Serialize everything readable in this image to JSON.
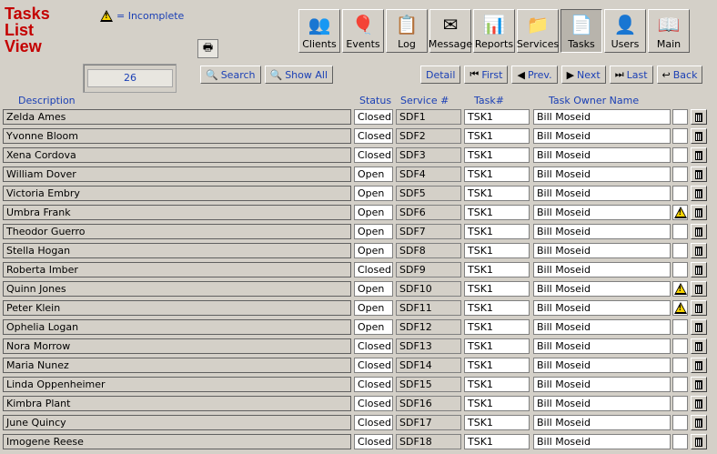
{
  "title": [
    "Tasks",
    "List",
    "View"
  ],
  "legend_text": "= Incomplete",
  "count": "26",
  "nav": [
    {
      "label": "Clients",
      "icon": "clients-icon"
    },
    {
      "label": "Events",
      "icon": "events-icon"
    },
    {
      "label": "Log",
      "icon": "log-icon"
    },
    {
      "label": "Message",
      "icon": "message-icon"
    },
    {
      "label": "Reports",
      "icon": "reports-icon"
    },
    {
      "label": "Services",
      "icon": "services-icon"
    },
    {
      "label": "Tasks",
      "icon": "tasks-icon"
    },
    {
      "label": "Users",
      "icon": "users-icon"
    },
    {
      "label": "Main",
      "icon": "main-icon"
    }
  ],
  "toolbar_left": [
    {
      "label": "Search"
    },
    {
      "label": "Show All"
    }
  ],
  "toolbar_right": [
    {
      "label": "Detail"
    },
    {
      "label": "First"
    },
    {
      "label": "Prev."
    },
    {
      "label": "Next"
    },
    {
      "label": "Last"
    },
    {
      "label": "Back"
    }
  ],
  "columns": {
    "description": "Description",
    "status": "Status",
    "service": "Service #",
    "task": "Task#",
    "owner": "Task Owner Name"
  },
  "rows": [
    {
      "desc": "Zelda Ames",
      "status": "Closed",
      "svc": "SDF1",
      "task": "TSK1",
      "owner": "Bill Moseid",
      "warn": false
    },
    {
      "desc": "Yvonne Bloom",
      "status": "Closed",
      "svc": "SDF2",
      "task": "TSK1",
      "owner": "Bill Moseid",
      "warn": false
    },
    {
      "desc": "Xena Cordova",
      "status": "Closed",
      "svc": "SDF3",
      "task": "TSK1",
      "owner": "Bill Moseid",
      "warn": false
    },
    {
      "desc": "William Dover",
      "status": "Open",
      "svc": "SDF4",
      "task": "TSK1",
      "owner": "Bill Moseid",
      "warn": false
    },
    {
      "desc": "Victoria Embry",
      "status": "Open",
      "svc": "SDF5",
      "task": "TSK1",
      "owner": "Bill Moseid",
      "warn": false
    },
    {
      "desc": "Umbra Frank",
      "status": "Open",
      "svc": "SDF6",
      "task": "TSK1",
      "owner": "Bill Moseid",
      "warn": true
    },
    {
      "desc": "Theodor Guerro",
      "status": "Open",
      "svc": "SDF7",
      "task": "TSK1",
      "owner": "Bill Moseid",
      "warn": false
    },
    {
      "desc": "Stella Hogan",
      "status": "Open",
      "svc": "SDF8",
      "task": "TSK1",
      "owner": "Bill Moseid",
      "warn": false
    },
    {
      "desc": "Roberta Imber",
      "status": "Closed",
      "svc": "SDF9",
      "task": "TSK1",
      "owner": "Bill Moseid",
      "warn": false
    },
    {
      "desc": "Quinn Jones",
      "status": "Open",
      "svc": "SDF10",
      "task": "TSK1",
      "owner": "Bill Moseid",
      "warn": true
    },
    {
      "desc": "Peter Klein",
      "status": "Open",
      "svc": "SDF11",
      "task": "TSK1",
      "owner": "Bill Moseid",
      "warn": true
    },
    {
      "desc": "Ophelia Logan",
      "status": "Open",
      "svc": "SDF12",
      "task": "TSK1",
      "owner": "Bill Moseid",
      "warn": false
    },
    {
      "desc": "Nora Morrow",
      "status": "Closed",
      "svc": "SDF13",
      "task": "TSK1",
      "owner": "Bill Moseid",
      "warn": false
    },
    {
      "desc": "Maria Nunez",
      "status": "Closed",
      "svc": "SDF14",
      "task": "TSK1",
      "owner": "Bill Moseid",
      "warn": false
    },
    {
      "desc": "Linda Oppenheimer",
      "status": "Closed",
      "svc": "SDF15",
      "task": "TSK1",
      "owner": "Bill Moseid",
      "warn": false
    },
    {
      "desc": "Kimbra Plant",
      "status": "Closed",
      "svc": "SDF16",
      "task": "TSK1",
      "owner": "Bill Moseid",
      "warn": false
    },
    {
      "desc": "June Quincy",
      "status": "Closed",
      "svc": "SDF17",
      "task": "TSK1",
      "owner": "Bill Moseid",
      "warn": false
    },
    {
      "desc": "Imogene Reese",
      "status": "Closed",
      "svc": "SDF18",
      "task": "TSK1",
      "owner": "Bill Moseid",
      "warn": false
    }
  ]
}
